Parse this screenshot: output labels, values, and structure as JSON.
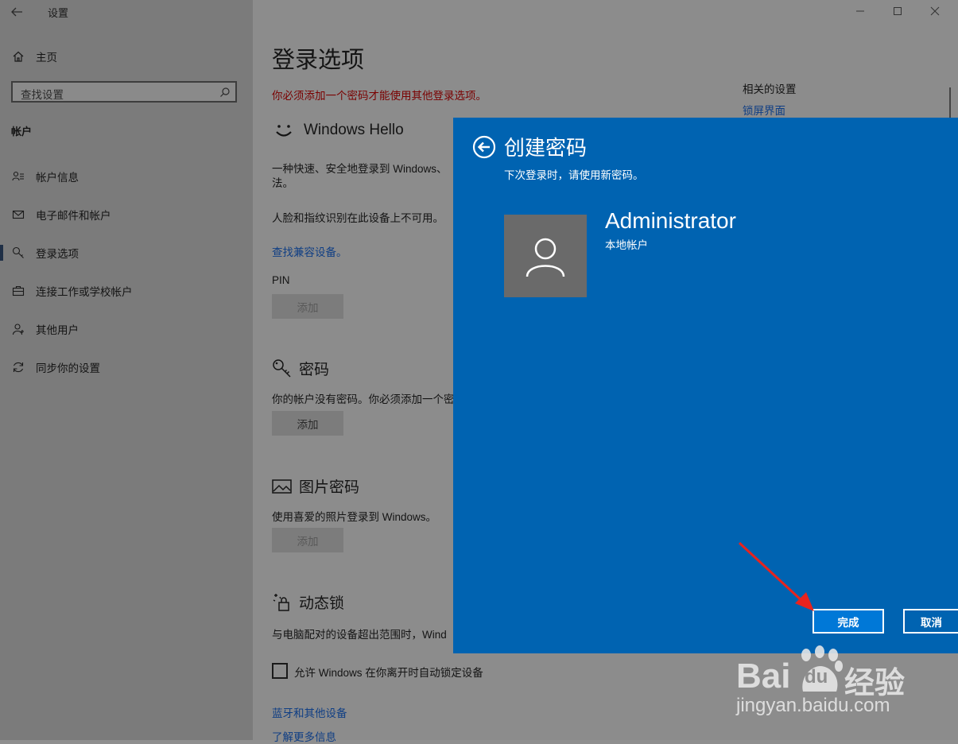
{
  "window": {
    "title": "设置"
  },
  "sidebar": {
    "home_label": "主页",
    "search_placeholder": "查找设置",
    "section_label": "帐户",
    "items": [
      {
        "label": "帐户信息",
        "icon": "account-info-icon"
      },
      {
        "label": "电子邮件和帐户",
        "icon": "mail-icon"
      },
      {
        "label": "登录选项",
        "icon": "key-icon",
        "selected": true
      },
      {
        "label": "连接工作或学校帐户",
        "icon": "briefcase-icon"
      },
      {
        "label": "其他用户",
        "icon": "person-icon"
      },
      {
        "label": "同步你的设置",
        "icon": "sync-icon"
      }
    ]
  },
  "main": {
    "page_title": "登录选项",
    "warning": "你必须添加一个密码才能使用其他登录选项。",
    "related": {
      "heading": "相关的设置",
      "link": "锁屏界面"
    },
    "hello": {
      "title": "Windows Hello",
      "desc_line1": "一种快速、安全地登录到 Windows、",
      "desc_line2": "法。",
      "unavailable": "人脸和指纹识别在此设备上不可用。",
      "link": "查找兼容设备。",
      "pin_label": "PIN",
      "pin_button": "添加"
    },
    "password": {
      "title": "密码",
      "desc": "你的帐户没有密码。你必须添加一个密",
      "button": "添加"
    },
    "picture": {
      "title": "图片密码",
      "desc": "使用喜爱的照片登录到 Windows。",
      "button": "添加"
    },
    "dynamic_lock": {
      "title": "动态锁",
      "desc": "与电脑配对的设备超出范围时，Wind",
      "checkbox_label": "允许 Windows 在你离开时自动锁定设备"
    },
    "links": {
      "bluetooth": "蓝牙和其他设备",
      "learn_more": "了解更多信息"
    }
  },
  "dialog": {
    "title": "创建密码",
    "subtitle": "下次登录时，请使用新密码。",
    "user_name": "Administrator",
    "account_type": "本地帐户",
    "finish_button": "完成",
    "cancel_button": "取消",
    "accent_color": "#0063b1"
  },
  "watermark": {
    "brand": "Bai",
    "brand_suffix": "du",
    "product": "经验",
    "url": "jingyan.baidu.com"
  }
}
